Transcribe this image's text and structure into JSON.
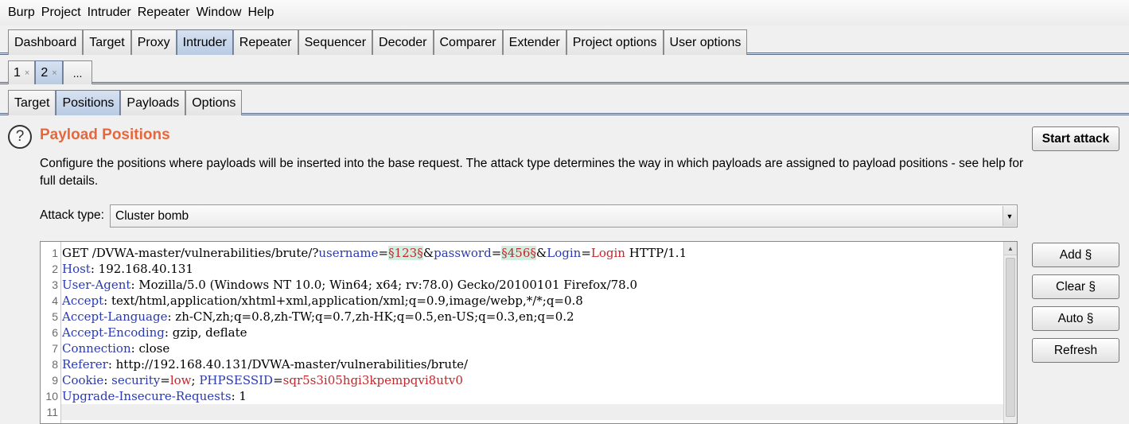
{
  "menu": [
    "Burp",
    "Project",
    "Intruder",
    "Repeater",
    "Window",
    "Help"
  ],
  "main_tabs": [
    {
      "label": "Dashboard",
      "active": false
    },
    {
      "label": "Target",
      "active": false
    },
    {
      "label": "Proxy",
      "active": false
    },
    {
      "label": "Intruder",
      "active": true
    },
    {
      "label": "Repeater",
      "active": false
    },
    {
      "label": "Sequencer",
      "active": false
    },
    {
      "label": "Decoder",
      "active": false
    },
    {
      "label": "Comparer",
      "active": false
    },
    {
      "label": "Extender",
      "active": false
    },
    {
      "label": "Project options",
      "active": false
    },
    {
      "label": "User options",
      "active": false
    }
  ],
  "instance_tabs": [
    {
      "label": "1",
      "close": "×",
      "active": false
    },
    {
      "label": "2",
      "close": "×",
      "active": true
    }
  ],
  "instance_more": "...",
  "position_tabs": [
    {
      "label": "Target",
      "active": false
    },
    {
      "label": "Positions",
      "active": true
    },
    {
      "label": "Payloads",
      "active": false
    },
    {
      "label": "Options",
      "active": false
    }
  ],
  "header": {
    "help_icon": "?",
    "title": "Payload Positions",
    "description": "Configure the positions where payloads will be inserted into the base request. The attack type determines the way in which payloads are assigned to payload positions - see help for full details.",
    "start_attack": "Start attack"
  },
  "attack": {
    "label": "Attack type:",
    "value": "Cluster bomb"
  },
  "request_lines": [
    {
      "num": "1",
      "parts": [
        {
          "t": "GET /DVWA-master/vulnerabilities/brute/?",
          "c": ""
        },
        {
          "t": "username",
          "c": "k"
        },
        {
          "t": "=",
          "c": ""
        },
        {
          "t": "§123§",
          "c": "pl"
        },
        {
          "t": "&",
          "c": ""
        },
        {
          "t": "password",
          "c": "k"
        },
        {
          "t": "=",
          "c": ""
        },
        {
          "t": "§456§",
          "c": "pl"
        },
        {
          "t": "&",
          "c": ""
        },
        {
          "t": "Login",
          "c": "k"
        },
        {
          "t": "=",
          "c": ""
        },
        {
          "t": "Login",
          "c": "v"
        },
        {
          "t": " HTTP/1.1",
          "c": ""
        }
      ]
    },
    {
      "num": "2",
      "parts": [
        {
          "t": "Host",
          "c": "k"
        },
        {
          "t": ": 192.168.40.131",
          "c": ""
        }
      ]
    },
    {
      "num": "3",
      "parts": [
        {
          "t": "User-Agent",
          "c": "k"
        },
        {
          "t": ": Mozilla/5.0 (Windows NT 10.0; Win64; x64; rv:78.0) Gecko/20100101 Firefox/78.0",
          "c": ""
        }
      ]
    },
    {
      "num": "4",
      "parts": [
        {
          "t": "Accept",
          "c": "k"
        },
        {
          "t": ": text/html,application/xhtml+xml,application/xml;q=0.9,image/webp,*/*;q=0.8",
          "c": ""
        }
      ]
    },
    {
      "num": "5",
      "parts": [
        {
          "t": "Accept-Language",
          "c": "k"
        },
        {
          "t": ": zh-CN,zh;q=0.8,zh-TW;q=0.7,zh-HK;q=0.5,en-US;q=0.3,en;q=0.2",
          "c": ""
        }
      ]
    },
    {
      "num": "6",
      "parts": [
        {
          "t": "Accept-Encoding",
          "c": "k"
        },
        {
          "t": ": gzip, deflate",
          "c": ""
        }
      ]
    },
    {
      "num": "7",
      "parts": [
        {
          "t": "Connection",
          "c": "k"
        },
        {
          "t": ": close",
          "c": ""
        }
      ]
    },
    {
      "num": "8",
      "parts": [
        {
          "t": "Referer",
          "c": "k"
        },
        {
          "t": ": http://192.168.40.131/DVWA-master/vulnerabilities/brute/",
          "c": ""
        }
      ]
    },
    {
      "num": "9",
      "parts": [
        {
          "t": "Cookie",
          "c": "k"
        },
        {
          "t": ": ",
          "c": ""
        },
        {
          "t": "security",
          "c": "k"
        },
        {
          "t": "=",
          "c": ""
        },
        {
          "t": "low",
          "c": "v"
        },
        {
          "t": "; ",
          "c": ""
        },
        {
          "t": "PHPSESSID",
          "c": "k"
        },
        {
          "t": "=",
          "c": ""
        },
        {
          "t": "sqr5s3i05hgi3kpempqvi8utv0",
          "c": "v"
        }
      ]
    },
    {
      "num": "10",
      "parts": [
        {
          "t": "Upgrade-Insecure-Requests",
          "c": "k"
        },
        {
          "t": ": 1",
          "c": ""
        }
      ]
    },
    {
      "num": "11",
      "parts": []
    }
  ],
  "side_buttons": [
    "Add §",
    "Clear §",
    "Auto §",
    "Refresh"
  ],
  "colors": {
    "title": "#e8673a",
    "key": "#2a3ab0",
    "value": "#c0282c",
    "payload_bg": "#cfeee0"
  }
}
